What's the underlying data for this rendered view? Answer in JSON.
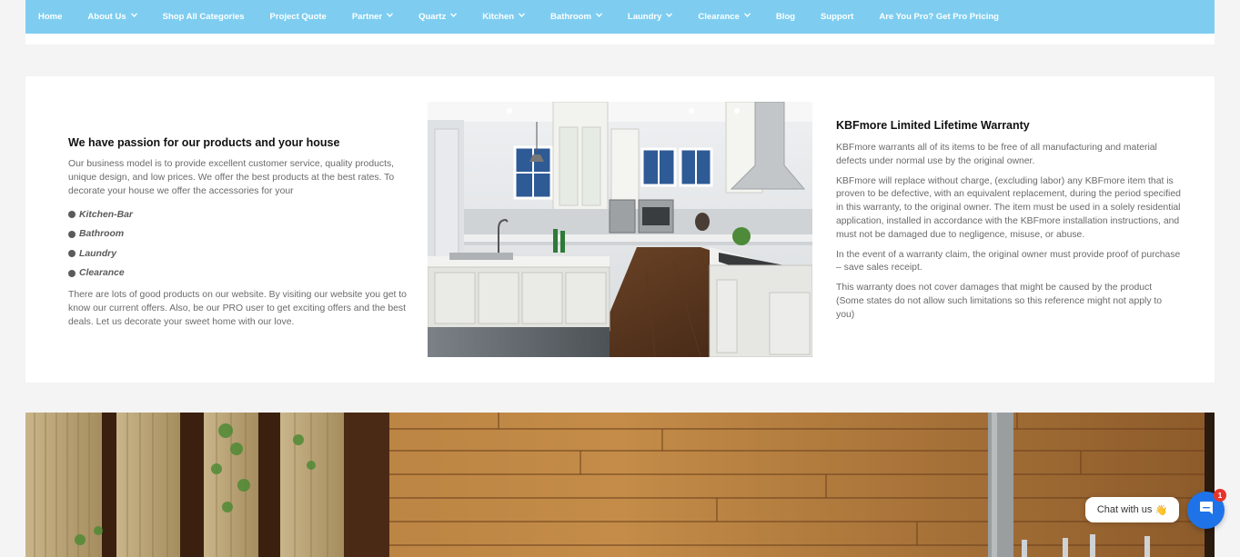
{
  "nav": {
    "items": [
      {
        "label": "Home",
        "has_dropdown": false
      },
      {
        "label": "About Us",
        "has_dropdown": true
      },
      {
        "label": "Shop All Categories",
        "has_dropdown": false
      },
      {
        "label": "Project Quote",
        "has_dropdown": false
      },
      {
        "label": "Partner",
        "has_dropdown": true
      },
      {
        "label": "Quartz",
        "has_dropdown": true
      },
      {
        "label": "Kitchen",
        "has_dropdown": true
      },
      {
        "label": "Bathroom",
        "has_dropdown": true
      },
      {
        "label": "Laundry",
        "has_dropdown": true
      },
      {
        "label": "Clearance",
        "has_dropdown": true
      },
      {
        "label": "Blog",
        "has_dropdown": false
      },
      {
        "label": "Support",
        "has_dropdown": false
      },
      {
        "label": "Are You Pro? Get Pro Pricing",
        "has_dropdown": false
      }
    ],
    "dropdown_icon": "chevron-down-icon",
    "background": "#7ecdf0"
  },
  "about": {
    "title": "We have passion for our products and your house",
    "intro": "Our business model is to provide excellent customer service, quality products, unique design, and low prices. We offer the best products at the best rates. To decorate your house we offer the accessories for your",
    "bullets": [
      "Kitchen-Bar",
      "Bathroom",
      "Laundry",
      "Clearance"
    ],
    "outro": "There are lots of good products on our website. By visiting our website you get to know our current offers. Also, be our PRO user to get exciting offers and the best deals. Let us decorate your sweet home with our love."
  },
  "warranty": {
    "title": "KBFmore Limited Lifetime Warranty",
    "paragraphs": [
      "KBFmore warrants all of its items to be free of all manufacturing and material defects under normal use by the original owner.",
      "KBFmore will replace without charge, (excluding labor) any KBFmore item that is proven to be defective, with an equivalent replacement, during the period specified in this warranty, to the original owner. The item must be used in a solely residential application, installed in accordance with the KBFmore installation instructions, and must not be damaged due to negligence, misuse, or abuse.",
      "In the event of a warranty claim, the original owner must provide proof of purchase – save sales receipt.",
      "This warranty does not cover damages that might be caused by the product (Some states do not allow such limitations so this reference might not apply to you)"
    ]
  },
  "chat": {
    "label": "Chat with us",
    "emoji": "👋",
    "badge_count": "1",
    "icon": "chat-icon",
    "color": "#1e73e8"
  }
}
